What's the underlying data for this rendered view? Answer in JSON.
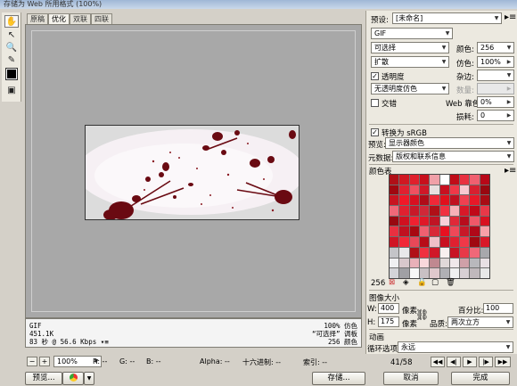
{
  "window": {
    "title": "存储为 Web 所用格式 (100%)"
  },
  "tabs": [
    {
      "label": "原稿",
      "active": false
    },
    {
      "label": "优化",
      "active": true
    },
    {
      "label": "双联",
      "active": false
    },
    {
      "label": "四联",
      "active": false
    }
  ],
  "info": {
    "left": [
      "GIF",
      "451.1K",
      "83 秒 @ 56.6 Kbps"
    ],
    "right": [
      "100% 仿色",
      "“可选择” 调板",
      "256 颜色"
    ]
  },
  "statusbar": {
    "zoom": "100%",
    "r": "R: --",
    "g": "G: --",
    "b": "B: --",
    "alpha": "Alpha: --",
    "hex": "十六进制: --",
    "index": "索引: --"
  },
  "buttons": {
    "preview": "预览...",
    "save": "存储...",
    "cancel": "取消",
    "done": "完成"
  },
  "settings": {
    "preset_label": "预设:",
    "preset_value": "[未命名]",
    "format": "GIF",
    "palette": "可选择",
    "dither_algo": "扩散",
    "transparency_label": "透明度",
    "transparency_checked": true,
    "matte_dither": "无透明度仿色",
    "interlaced_label": "交错",
    "interlaced_checked": false,
    "colors_label": "颜色:",
    "colors_value": "256",
    "dither_label": "仿色:",
    "dither_value": "100%",
    "matte_label": "杂边:",
    "amount_label": "数量:",
    "web_snap_label": "Web 靠色:",
    "web_snap_value": "0%",
    "lossy_label": "损耗:",
    "lossy_value": "0",
    "convert_srgb_label": "转换为 sRGB",
    "convert_srgb_checked": true,
    "preview_label": "预览:",
    "preview_value": "显示器颜色",
    "metadata_label": "元数据:",
    "metadata_value": "版权和联系信息"
  },
  "color_table": {
    "title": "颜色表",
    "count": "256",
    "colors": [
      "#b01018",
      "#d01822",
      "#e0202c",
      "#c8101c",
      "#f0a0a8",
      "#ffffff",
      "#c00c18",
      "#e83040",
      "#f06070",
      "#b80818",
      "#a00810",
      "#e02030",
      "#f05060",
      "#d01828",
      "#e8e0e0",
      "#c81020",
      "#f03848",
      "#f8c8d0",
      "#d82030",
      "#980810",
      "#c81420",
      "#f01828",
      "#d81020",
      "#b00c18",
      "#f02838",
      "#e0101c",
      "#c01020",
      "#f04050",
      "#e81828",
      "#a80c14",
      "#f06878",
      "#e02030",
      "#c81828",
      "#d02838",
      "#b01018",
      "#f03040",
      "#f8b0b8",
      "#d81828",
      "#c00818",
      "#e83848",
      "#980810",
      "#d01020",
      "#f02030",
      "#e01828",
      "#c01424",
      "#f8d0d8",
      "#e02838",
      "#b80c1c",
      "#f05868",
      "#d81020",
      "#e83040",
      "#c01020",
      "#a80810",
      "#f06070",
      "#d82838",
      "#e81020",
      "#f04858",
      "#c81828",
      "#b00818",
      "#f8a0a8",
      "#d01424",
      "#f02838",
      "#e84858",
      "#b80c18",
      "#f0c0c8",
      "#c81020",
      "#e02030",
      "#f03848",
      "#a00810",
      "#d81828",
      "#c4c4c8",
      "#e8e8ea",
      "#b01018",
      "#f03040",
      "#d01828",
      "#f8f0f0",
      "#c81424",
      "#e83848",
      "#f06878",
      "#a8a8ac",
      "#f0f0f2",
      "#d8c8cc",
      "#e8b0b8",
      "#f8d8dc",
      "#c08890",
      "#e0d8d8",
      "#f0e8ea",
      "#d0a0a8",
      "#b8b8bc",
      "#e8e0e4",
      "#d4d4d8",
      "#a0a0a4",
      "#f8f8f8",
      "#c8c0c4",
      "#e0c8cc",
      "#b0b0b4",
      "#f0f0f0",
      "#d8d0d4",
      "#c0b8bc",
      "#e8e8e8"
    ]
  },
  "image_size": {
    "title": "图像大小",
    "w_label": "W:",
    "w_value": "400",
    "h_label": "H:",
    "h_value": "175",
    "unit": "像素",
    "percent_label": "百分比:",
    "percent_value": "100",
    "quality_label": "品质:",
    "quality_value": "两次立方"
  },
  "animation": {
    "title": "动画",
    "loop_label": "循环选项:",
    "loop_value": "永远",
    "frame_counter": "41/58"
  }
}
